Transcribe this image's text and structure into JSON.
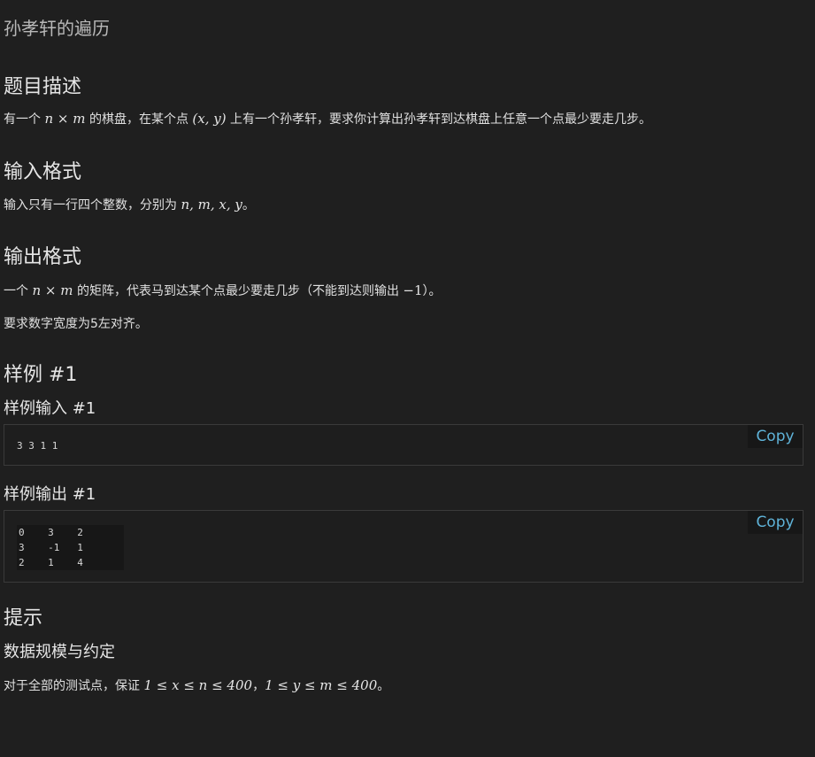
{
  "title": "孙孝轩的遍历",
  "description": {
    "heading": "题目描述",
    "text_before": "有一个 ",
    "math1": {
      "n": "n",
      "times": "×",
      "m": "m"
    },
    "text_mid": " 的棋盘，在某个点 ",
    "math2": "(x, y)",
    "text_after": " 上有一个孙孝轩，要求你计算出孙孝轩到达棋盘上任意一个点最少要走几步。"
  },
  "input_format": {
    "heading": "输入格式",
    "text_before": "输入只有一行四个整数，分别为 ",
    "math": "n, m, x, y",
    "text_after": "。"
  },
  "output_format": {
    "heading": "输出格式",
    "line1_before": "一个 ",
    "line1_math_n": "n",
    "line1_math_times": "×",
    "line1_math_m": "m",
    "line1_mid": " 的矩阵，代表马到达某个点最少要走几步（不能到达则输出 ",
    "line1_math_neg": "−1",
    "line1_after": "）。",
    "line2": "要求数字宽度为5左对齐。"
  },
  "sample": {
    "heading": "样例 #1",
    "input_heading": "样例输入 #1",
    "input_code": "3 3 1 1",
    "output_heading": "样例输出 #1",
    "output_code": "0    3    2\n3    -1   1\n2    1    4",
    "copy_label": "Copy"
  },
  "hint": {
    "heading": "提示",
    "subheading": "数据规模与约定",
    "text_before": "对于全部的测试点，保证 ",
    "math1": "1 ≤ x ≤ n ≤ 400",
    "text_mid": "，",
    "math2": "1 ≤ y ≤ m ≤ 400",
    "text_after": "。"
  },
  "colors": {
    "background": "#1f1f1f",
    "copy_accent": "#5fb3d9"
  }
}
